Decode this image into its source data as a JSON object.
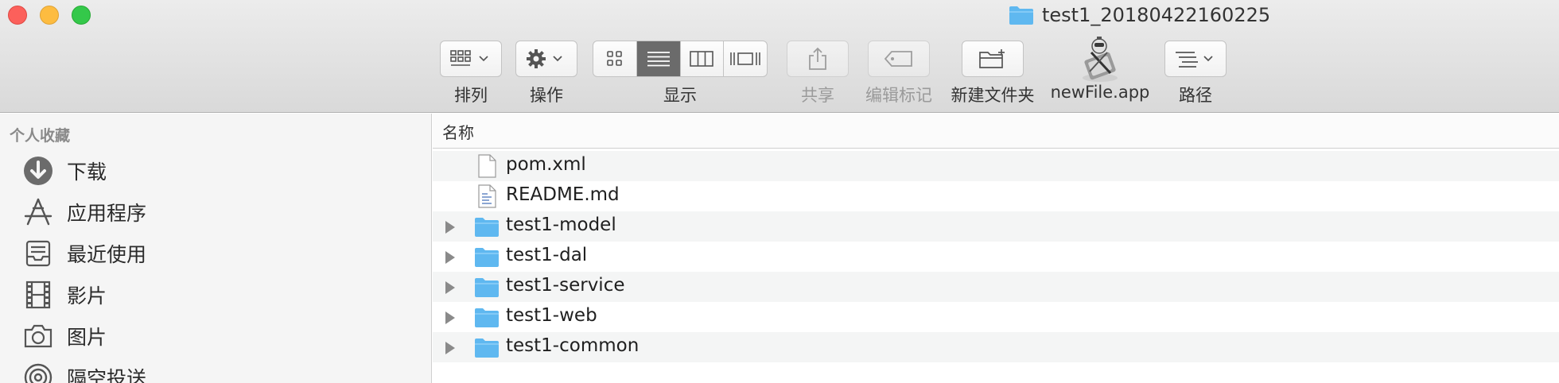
{
  "window": {
    "title": "test1_20180422160225"
  },
  "toolbar": {
    "arrange_label": "排列",
    "action_label": "操作",
    "view_label": "显示",
    "share_label": "共享",
    "tags_label": "编辑标记",
    "new_folder_label": "新建文件夹",
    "app_label": "newFile.app",
    "path_label": "路径"
  },
  "sidebar": {
    "header": "个人收藏",
    "items": [
      {
        "label": "下载",
        "icon": "download-icon"
      },
      {
        "label": "应用程序",
        "icon": "applications-icon"
      },
      {
        "label": "最近使用",
        "icon": "recents-icon"
      },
      {
        "label": "影片",
        "icon": "movies-icon"
      },
      {
        "label": "图片",
        "icon": "pictures-icon"
      },
      {
        "label": "隔空投送",
        "icon": "airdrop-icon"
      }
    ]
  },
  "list": {
    "column_name": "名称",
    "rows": [
      {
        "name": "pom.xml",
        "kind": "file"
      },
      {
        "name": "README.md",
        "kind": "doc"
      },
      {
        "name": "test1-model",
        "kind": "folder"
      },
      {
        "name": "test1-dal",
        "kind": "folder"
      },
      {
        "name": "test1-service",
        "kind": "folder"
      },
      {
        "name": "test1-web",
        "kind": "folder"
      },
      {
        "name": "test1-common",
        "kind": "folder"
      }
    ]
  },
  "colors": {
    "folder": "#5fb8f0",
    "close": "#fc605b",
    "minimize": "#fdbc40",
    "maximize": "#34c84a"
  }
}
